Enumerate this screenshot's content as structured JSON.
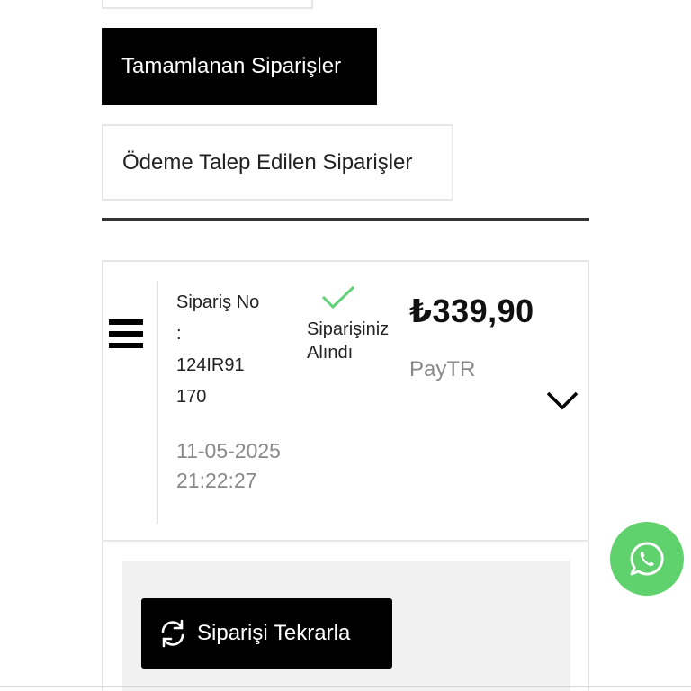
{
  "filters": {
    "completed_label": "Tamamlanan Siparişler",
    "payment_requested_label": "Ödeme Talep Edilen Siparişler"
  },
  "order": {
    "number_label": "Sipariş No :",
    "number_value": "124IR91170",
    "date": "11-05-2025 21:22:27",
    "status": "Siparişiniz Alındı",
    "price": "₺339,90",
    "payment_method": "PayTR",
    "reorder_label": "Siparişi Tekrarla"
  },
  "icons": {
    "menu": "hamburger-icon",
    "status": "check-icon",
    "expand": "chevron-down-icon",
    "reorder": "refresh-icon",
    "chat": "whatsapp-icon"
  },
  "colors": {
    "primary_button": "#000000",
    "status_check": "#5fcf78",
    "whatsapp": "#5fd26d",
    "muted_text": "#8a8a8a"
  }
}
